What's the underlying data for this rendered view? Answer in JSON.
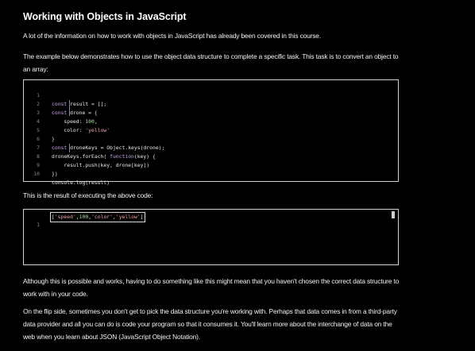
{
  "heading": "Working with Objects in JavaScript",
  "intro": "A lot of the information on how to work with objects in JavaScript has already been covered in this course.",
  "example_intro": "The example below demonstrates how to use the object data structure to complete a specific task. This task is to convert an object to an array:",
  "code_example": {
    "lines": [
      {
        "n": "1",
        "text": "const result = [];"
      },
      {
        "n": "2",
        "text": "const drone = {"
      },
      {
        "n": "3",
        "text": "    speed: 100,"
      },
      {
        "n": "4",
        "text": "    color: 'yellow'"
      },
      {
        "n": "5",
        "text": "}"
      },
      {
        "n": "6",
        "text": "const droneKeys = Object.keys(drone);"
      },
      {
        "n": "7",
        "text": "droneKeys.forEach( function(key) {"
      },
      {
        "n": "8",
        "text": "    result.push(key, drone[key])"
      },
      {
        "n": "9",
        "text": "})"
      },
      {
        "n": "10",
        "text": "console.log(result)"
      }
    ]
  },
  "result_intro": "This is the result of executing the above code:",
  "result_output": {
    "line_number": "1",
    "text": "['speed',100,'color','yellow']"
  },
  "paragraph_after_1": "Although this is possible and works, having to do something like this might mean that you haven't chosen the correct data structure to work with in your code.",
  "paragraph_after_2": "On the flip side, sometimes you don't get to pick the data structure you're working with. Perhaps that data comes in from a third-party data provider and all you can do is code your program so that it consumes it. You'll learn more about the interchange of data on the web when you learn about JSON (JavaScript Object Notation)."
}
